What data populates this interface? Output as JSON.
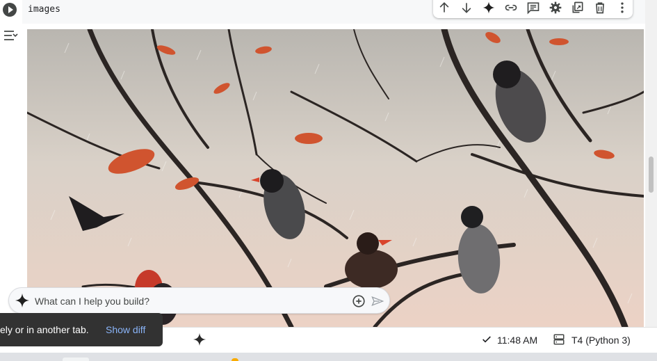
{
  "cell": {
    "code": "images"
  },
  "toolbar": {
    "buttons": [
      {
        "icon": "arrow-up-icon"
      },
      {
        "icon": "arrow-down-icon"
      },
      {
        "icon": "gemini-sparkle-icon"
      },
      {
        "icon": "link-icon"
      },
      {
        "icon": "comment-icon"
      },
      {
        "icon": "gear-icon"
      },
      {
        "icon": "mirror-cell-icon"
      },
      {
        "icon": "trash-icon"
      },
      {
        "icon": "more-vert-icon"
      }
    ]
  },
  "prompt": {
    "placeholder": "What can I help you build?"
  },
  "snackbar": {
    "text": "ely or in another tab.",
    "action": "Show diff"
  },
  "status": {
    "time": "11:48 AM",
    "runtime": "T4 (Python 3)"
  },
  "colors": {
    "accent_link": "#8ab4f8",
    "snackbar_bg": "#323232",
    "icon": "#444746"
  }
}
